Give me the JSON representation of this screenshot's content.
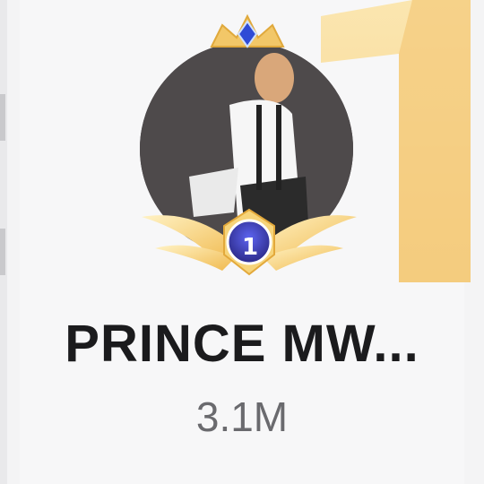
{
  "profile": {
    "name": "PRINCE MW...",
    "followers": "3.1M",
    "rank": "1"
  },
  "icons": {
    "crown": "crown-icon",
    "laurel": "laurel-wreath-icon",
    "rank_background": "rank-number-background"
  },
  "colors": {
    "gold": "#f2c768",
    "gold_light": "#fbe3a6",
    "badge_blue": "#3d3aa8",
    "name_text": "#1b1b1d",
    "followers_text": "#6a6a6e"
  }
}
